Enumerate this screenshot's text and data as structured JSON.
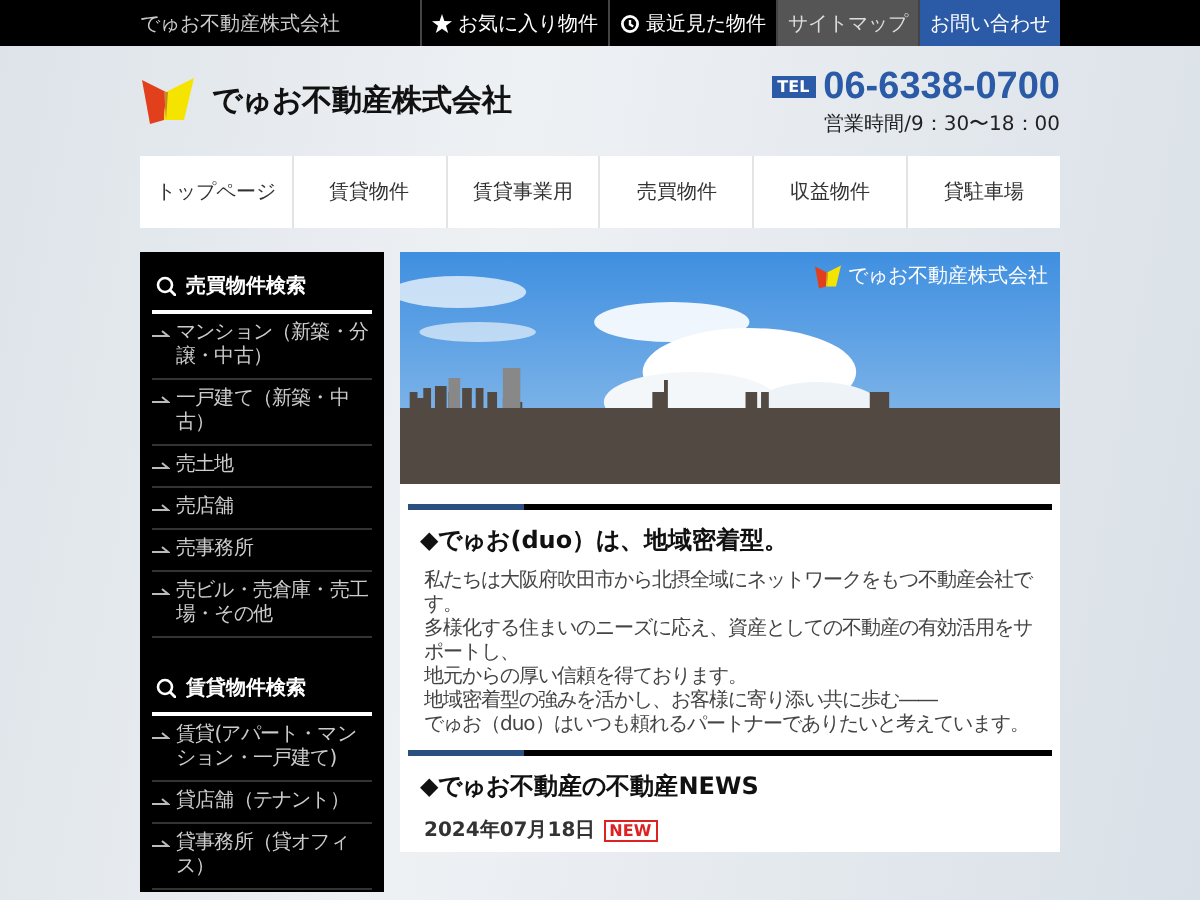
{
  "top_bar": {
    "site_name": "でゅお不動産株式会社",
    "links": [
      {
        "label": "お気に入り物件",
        "kind": "favorite"
      },
      {
        "label": "最近見た物件",
        "kind": "history"
      },
      {
        "label": "サイトマップ",
        "kind": "sitemap"
      },
      {
        "label": "お問い合わせ",
        "kind": "contact"
      }
    ]
  },
  "header": {
    "company_name": "でゅお不動産株式会社",
    "tel_label": "TEL",
    "phone": "06-6338-0700",
    "hours": "営業時間/9：30〜18：00"
  },
  "nav": [
    {
      "label": "トップページ"
    },
    {
      "label": "賃貸物件"
    },
    {
      "label": "賃貸事業用"
    },
    {
      "label": "売買物件"
    },
    {
      "label": "収益物件"
    },
    {
      "label": "貸駐車場"
    }
  ],
  "sidebar": {
    "sections": [
      {
        "title": "売買物件検索",
        "items": [
          "マンション（新築・分譲・中古）",
          "一戸建て（新築・中古）",
          "売土地",
          "売店舗",
          "売事務所",
          "売ビル・売倉庫・売工場・その他"
        ]
      },
      {
        "title": "賃貸物件検索",
        "items": [
          "賃貸(アパート・マンション・一戸建て)",
          "貸店舗（テナント）",
          "貸事務所（貸オフィス）"
        ]
      }
    ]
  },
  "hero": {
    "logo_text": "でゅお不動産株式会社"
  },
  "intro": {
    "heading": "◆でゅお(duo）は、地域密着型。",
    "lines": [
      "私たちは大阪府吹田市から北摂全域にネットワークをもつ不動産会社です。",
      "多様化する住まいのニーズに応え、資産としての不動産の有効活用をサポートし、",
      "地元からの厚い信頼を得ております。",
      "地域密着型の強みを活かし、お客様に寄り添い共に歩む――",
      "でゅお（duo）はいつも頼れるパートナーでありたいと考えています。"
    ]
  },
  "news": {
    "heading": "◆でゅお不動産の不動産NEWS",
    "items": [
      {
        "date": "2024年07月18日",
        "badge": "NEW"
      }
    ]
  }
}
